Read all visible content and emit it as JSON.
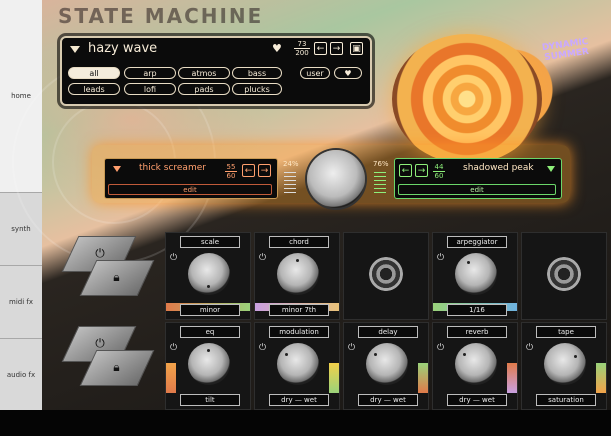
{
  "app": {
    "title": "STATE MACHINE",
    "brand_stamp": "DYNAMIC SUMMER"
  },
  "sidebar": {
    "items": [
      {
        "label": "home"
      },
      {
        "label": "synth"
      },
      {
        "label": "midi fx"
      },
      {
        "label": "audio fx"
      }
    ]
  },
  "preset": {
    "name": "hazy wave",
    "count": {
      "current": "73",
      "total": "200"
    },
    "tags_row1": [
      "all",
      "arp",
      "atmos",
      "bass"
    ],
    "tags_row2": [
      "leads",
      "lofi",
      "pads",
      "plucks"
    ],
    "user_label": "user",
    "active_tag": "all"
  },
  "layers": {
    "left": {
      "name": "thick screamer",
      "count_current": "55",
      "count_total": "60",
      "edit_label": "edit",
      "level": "24%"
    },
    "right": {
      "name": "shadowed peak",
      "count_current": "44",
      "count_total": "60",
      "edit_label": "edit",
      "level": "76%"
    }
  },
  "midi_fx": [
    {
      "label": "scale",
      "value": "minor"
    },
    {
      "label": "chord",
      "value": "minor 7th"
    },
    {
      "label": "",
      "value": ""
    },
    {
      "label": "arpeggiator",
      "value": "1/16"
    },
    {
      "label": "",
      "value": ""
    }
  ],
  "audio_fx": [
    {
      "label": "eq",
      "value": "tilt"
    },
    {
      "label": "modulation",
      "value": "dry — wet"
    },
    {
      "label": "delay",
      "value": "dry — wet"
    },
    {
      "label": "reverb",
      "value": "dry — wet"
    },
    {
      "label": "tape",
      "value": "saturation"
    }
  ],
  "colors": {
    "accent_orange": "#f2a34a",
    "layer_left": "#ff9f6e",
    "layer_right": "#8ef07a"
  }
}
